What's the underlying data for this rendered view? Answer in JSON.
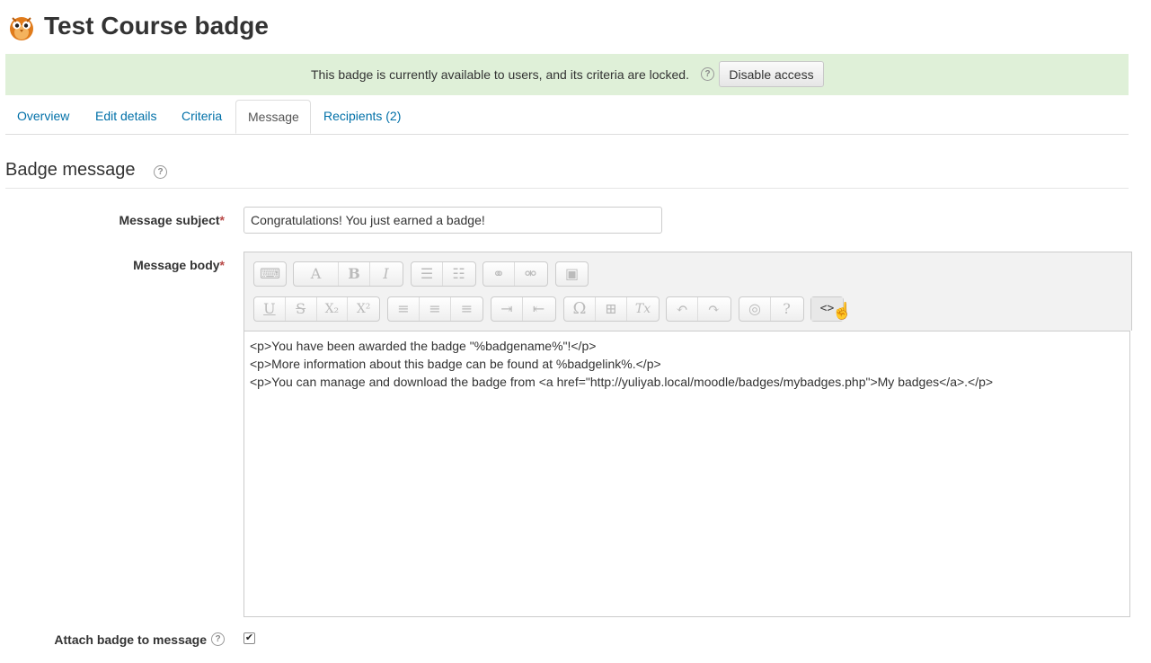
{
  "header": {
    "title": "Test Course badge",
    "icon": "badge-owl-icon"
  },
  "alert": {
    "text": "This badge is currently available to users, and its criteria are locked.",
    "help_icon": "?",
    "button_label": "Disable access"
  },
  "tabs": [
    {
      "label": "Overview",
      "active": false
    },
    {
      "label": "Edit details",
      "active": false
    },
    {
      "label": "Criteria",
      "active": false
    },
    {
      "label": "Message",
      "active": true
    },
    {
      "label": "Recipients (2)",
      "active": false
    }
  ],
  "section": {
    "title": "Badge message",
    "help_icon": "?"
  },
  "form": {
    "subject_label": "Message subject",
    "subject_value": "Congratulations! You just earned a badge!",
    "body_label": "Message body",
    "required_mark": "*",
    "attach_label": "Attach badge to message",
    "attach_checked": true,
    "check_mark": "✔"
  },
  "editor": {
    "lines": [
      "<p>You have been awarded the badge \"%badgename%\"!</p>",
      "<p>More information about this badge can be found at %badgelink%.</p>",
      "<p>You can manage and download the badge from <a href=\"http://yuliyab.local/moodle/badges/mybadges.php\">My badges</a>.</p>"
    ],
    "toolbar": {
      "toggle": "⌨",
      "style": "A",
      "bold": "B",
      "italic": "I",
      "ul": "☰",
      "ol": "☷",
      "link": "⚭",
      "unlink": "⚮",
      "image": "▣",
      "underline": "U",
      "strike": "S",
      "sub": "X₂",
      "sup": "X²",
      "align_left": "≡",
      "align_center": "≡",
      "align_right": "≡",
      "indent": "⇥",
      "outdent": "⇤",
      "char": "Ω",
      "table": "⊞",
      "clear": "Tx",
      "undo": "↶",
      "redo": "↷",
      "screenreader": "◎",
      "accessibility": "?",
      "html": "<>"
    }
  }
}
